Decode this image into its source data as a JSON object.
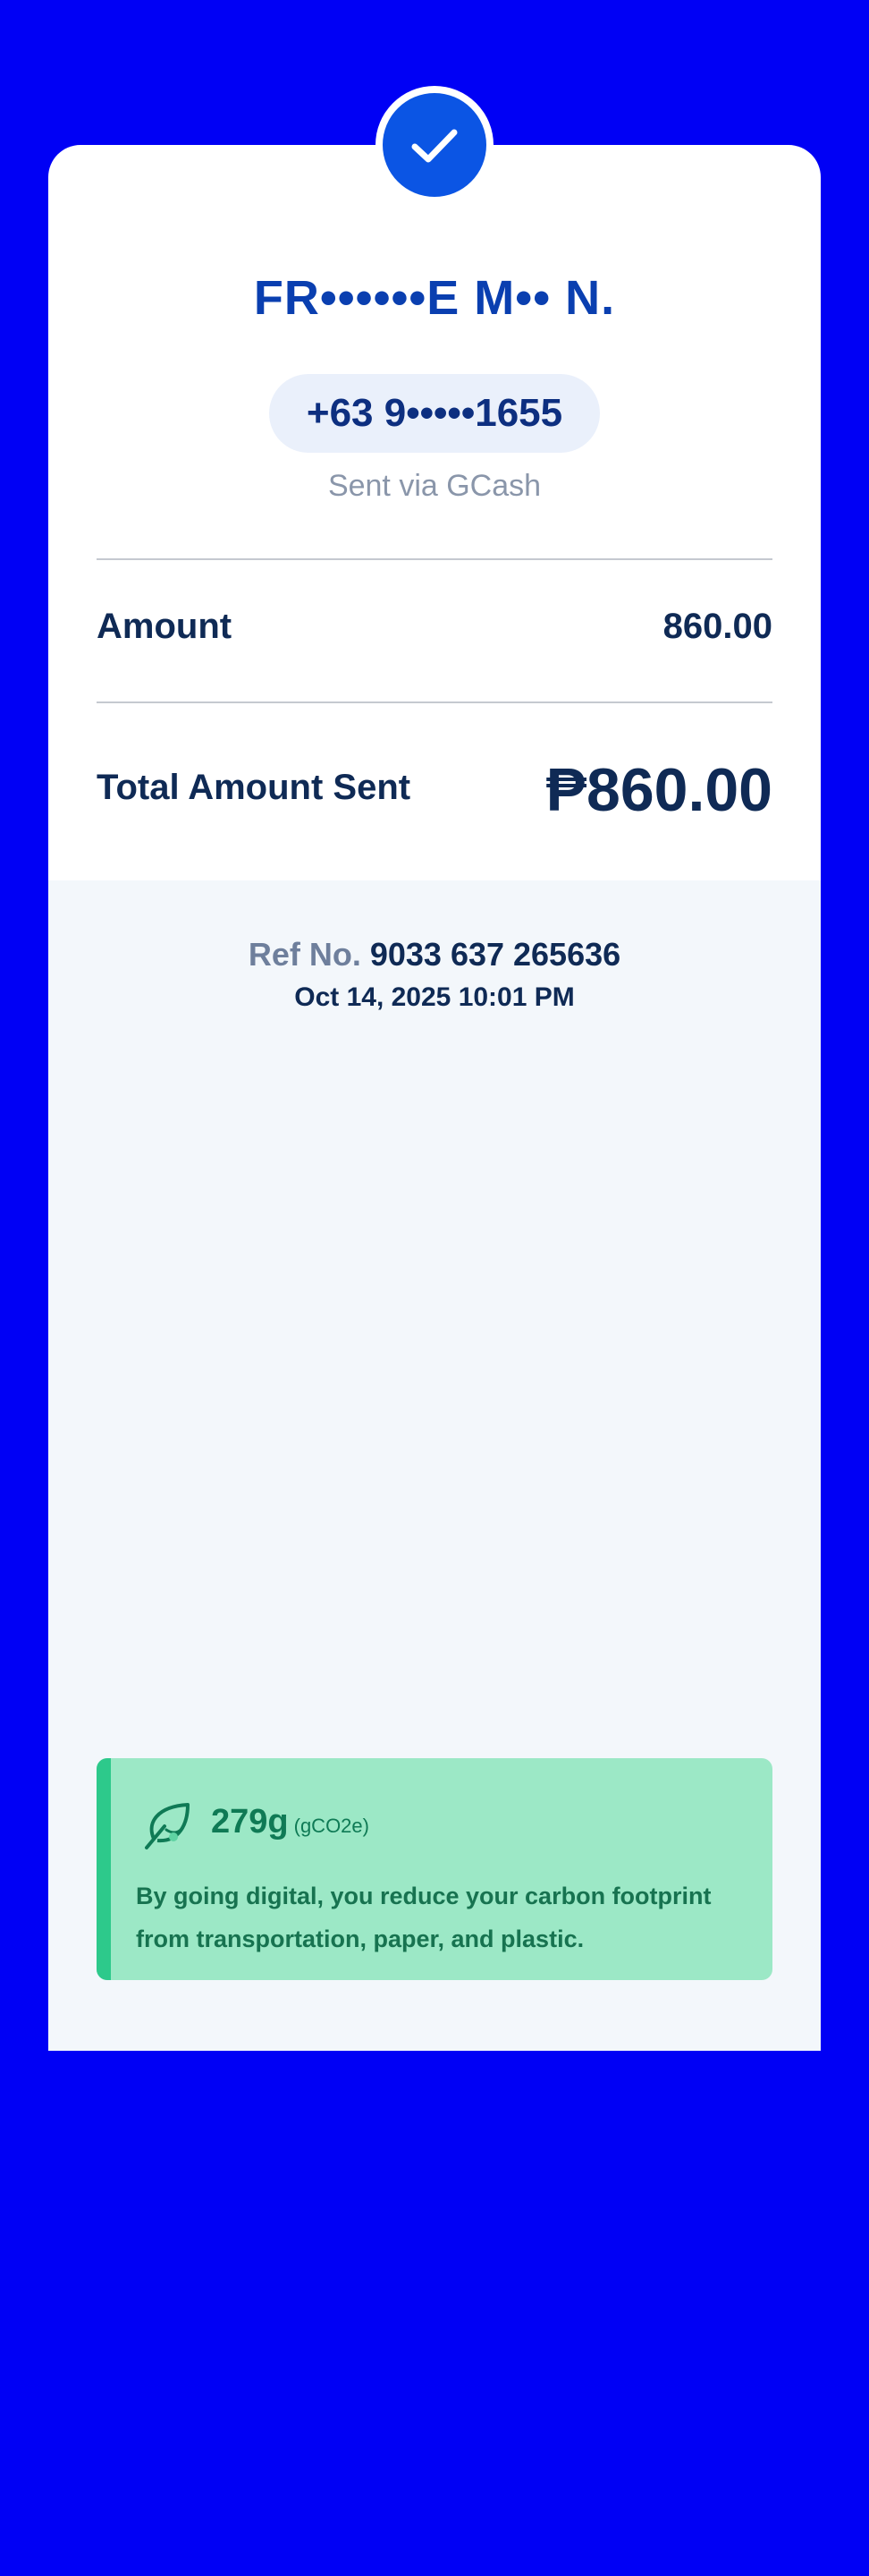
{
  "receipt": {
    "recipient_name": "FR••••••E M•• N.",
    "phone": "+63 9•••••1655",
    "sent_via": "Sent via GCash",
    "amount_label": "Amount",
    "amount_value": "860.00",
    "total_label": "Total Amount Sent",
    "total_value": "₱860.00",
    "ref_label": "Ref No.",
    "ref_number": "9033 637 265636",
    "date": "Oct 14, 2025 10:01 PM"
  },
  "eco": {
    "icon": "leaf-icon",
    "amount": "279g",
    "unit": "(gCO2e)",
    "message": "By going digital, you reduce your carbon footprint from transportation, paper, and plastic."
  },
  "colors": {
    "background": "#0000f5",
    "accent_blue": "#0b55e4",
    "eco_green": "#9ce8c6"
  }
}
